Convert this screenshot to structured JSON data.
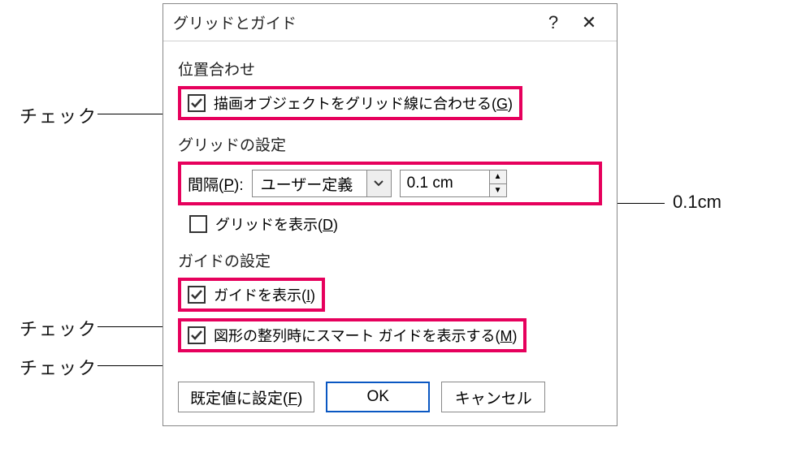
{
  "dialog": {
    "title": "グリッドとガイド",
    "help_symbol": "?",
    "close_symbol": "✕"
  },
  "alignment": {
    "section": "位置合わせ",
    "snap_label_pre": "描画オブジェクトをグリッド線に合わせる(",
    "snap_key": "G",
    "snap_label_post": ")"
  },
  "grid": {
    "section": "グリッドの設定",
    "spacing_label_pre": "間隔(",
    "spacing_key": "P",
    "spacing_label_post": "):",
    "combo_value": "ユーザー定義",
    "spinner_value": "0.1 cm",
    "show_grid_pre": "グリッドを表示(",
    "show_grid_key": "D",
    "show_grid_post": ")"
  },
  "guides": {
    "section": "ガイドの設定",
    "show_guides_pre": "ガイドを表示(",
    "show_guides_key": "I",
    "show_guides_post": ")",
    "smart_pre": "図形の整列時にスマート ガイドを表示する(",
    "smart_key": "M",
    "smart_post": ")"
  },
  "buttons": {
    "defaults_pre": "既定値に設定(",
    "defaults_key": "F",
    "defaults_post": ")",
    "ok": "OK",
    "cancel": "キャンセル"
  },
  "annotations": {
    "check": "チェック",
    "value": "0.1cm"
  }
}
